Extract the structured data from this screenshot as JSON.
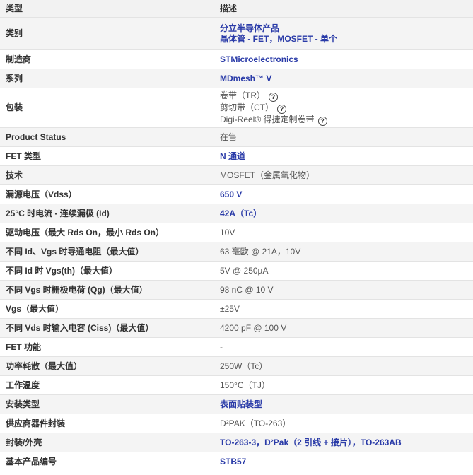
{
  "header": {
    "col1": "类型",
    "col2": "描述"
  },
  "rows": [
    {
      "attr": "类别",
      "lines": [
        "分立半导体产品",
        "晶体管 - FET，MOSFET - 单个"
      ]
    },
    {
      "attr": "制造商",
      "value": "STMicroelectronics"
    },
    {
      "attr": "系列",
      "value": "MDmesh™ V"
    },
    {
      "attr": "包装",
      "lines": [
        "卷带（TR）",
        "剪切带（CT）",
        "Digi-Reel® 得捷定制卷带"
      ],
      "help_icon": "question-circle-icon"
    },
    {
      "attr": "Product Status",
      "value": "在售"
    },
    {
      "attr": "FET 类型",
      "value": "N 通道"
    },
    {
      "attr": "技术",
      "value": "MOSFET（金属氧化物）"
    },
    {
      "attr": "漏源电压（Vdss）",
      "value": "650 V"
    },
    {
      "attr": "25°C 时电流 - 连续漏极 (Id)",
      "value": "42A（Tc）"
    },
    {
      "attr": "驱动电压（最大 Rds On，最小 Rds On）",
      "value": "10V"
    },
    {
      "attr": "不同 Id、Vgs 时导通电阻（最大值）",
      "value": "63 毫欧 @ 21A，10V"
    },
    {
      "attr": "不同 Id 时 Vgs(th)（最大值）",
      "value": "5V @ 250µA"
    },
    {
      "attr": "不同 Vgs 时栅极电荷 (Qg)（最大值）",
      "value": "98 nC @ 10 V"
    },
    {
      "attr": "Vgs（最大值）",
      "value": "±25V"
    },
    {
      "attr": "不同 Vds 时输入电容 (Ciss)（最大值）",
      "value": "4200 pF @ 100 V"
    },
    {
      "attr": "FET 功能",
      "value": "-"
    },
    {
      "attr": "功率耗散（最大值）",
      "value": "250W（Tc）"
    },
    {
      "attr": "工作温度",
      "value": "150°C（TJ）"
    },
    {
      "attr": "安装类型",
      "value": "表面贴装型"
    },
    {
      "attr": "供应商器件封装",
      "value": "D²PAK（TO-263）"
    },
    {
      "attr": "封装/外壳",
      "value": "TO-263-3，D²Pak（2 引线 + 接片），TO-263AB"
    },
    {
      "attr": "基本产品编号",
      "value": "STB57"
    }
  ],
  "colors": {
    "link": "#2a3ba8",
    "zebra": "#f4f4f4",
    "border": "#e3e3e3"
  }
}
